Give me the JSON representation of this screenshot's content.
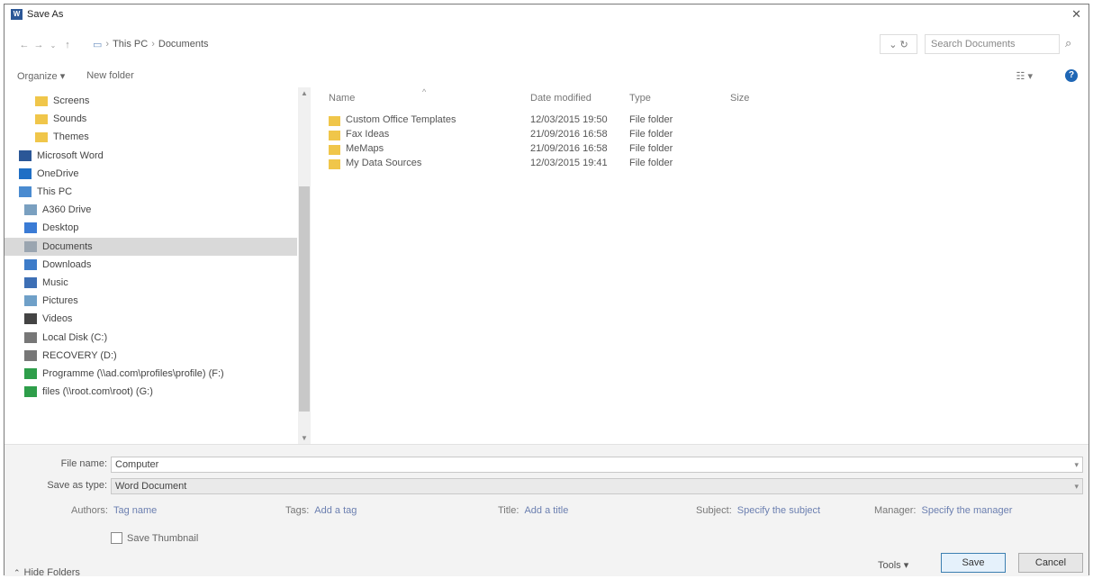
{
  "window": {
    "title": "Save As",
    "app_icon": "word-icon"
  },
  "address": {
    "path": [
      "This PC",
      "Documents"
    ],
    "search_placeholder": "Search Documents"
  },
  "toolbar": {
    "organize": "Organize ▾",
    "new_folder": "New folder"
  },
  "nav": {
    "items": [
      {
        "label": "Screens",
        "icon": "folder-icon"
      },
      {
        "label": "Sounds",
        "icon": "folder-icon"
      },
      {
        "label": "Themes",
        "icon": "folder-icon"
      },
      {
        "label": "Microsoft Word",
        "icon": "word-icon"
      },
      {
        "label": "OneDrive",
        "icon": "cloud-icon"
      },
      {
        "label": "This PC",
        "icon": "pc-icon"
      },
      {
        "label": "A360 Drive",
        "icon": "drive-icon"
      },
      {
        "label": "Desktop",
        "icon": "desktop-icon"
      },
      {
        "label": "Documents",
        "icon": "documents-icon",
        "selected": true
      },
      {
        "label": "Downloads",
        "icon": "download-icon"
      },
      {
        "label": "Music",
        "icon": "music-icon"
      },
      {
        "label": "Pictures",
        "icon": "pictures-icon"
      },
      {
        "label": "Videos",
        "icon": "videos-icon"
      },
      {
        "label": "Local Disk (C:)",
        "icon": "disk-icon"
      },
      {
        "label": "RECOVERY (D:)",
        "icon": "disk-icon"
      },
      {
        "label": "Programme (\\\\ad.com\\profiles\\profile) (F:)",
        "icon": "network-drive-icon"
      },
      {
        "label": "files (\\\\root.com\\root) (G:)",
        "icon": "network-drive-icon"
      }
    ]
  },
  "files": {
    "columns": [
      "Name",
      "Date modified",
      "Type",
      "Size"
    ],
    "rows": [
      {
        "name": "Custom Office Templates",
        "date": "12/03/2015 19:50",
        "type": "File folder"
      },
      {
        "name": "Fax Ideas",
        "date": "21/09/2016 16:58",
        "type": "File folder"
      },
      {
        "name": "MeMaps",
        "date": "21/09/2016 16:58",
        "type": "File folder"
      },
      {
        "name": "My Data Sources",
        "date": "12/03/2015 19:41",
        "type": "File folder"
      }
    ]
  },
  "form": {
    "filename_label": "File name:",
    "filename_value": "Computer",
    "savetype_label": "Save as type:",
    "savetype_value": "Word Document",
    "meta": [
      {
        "label": "Authors:",
        "value": "Tag name"
      },
      {
        "label": "Tags:",
        "value": "Add a tag"
      },
      {
        "label": "Title:",
        "value": "Add a title"
      },
      {
        "label": "Subject:",
        "value": "Specify the subject"
      },
      {
        "label": "Manager:",
        "value": "Specify the manager"
      }
    ],
    "thumbnail_label": "Save Thumbnail"
  },
  "footer": {
    "hide_folders": "Hide Folders",
    "tools": "Tools ▾",
    "save": "Save",
    "cancel": "Cancel"
  }
}
